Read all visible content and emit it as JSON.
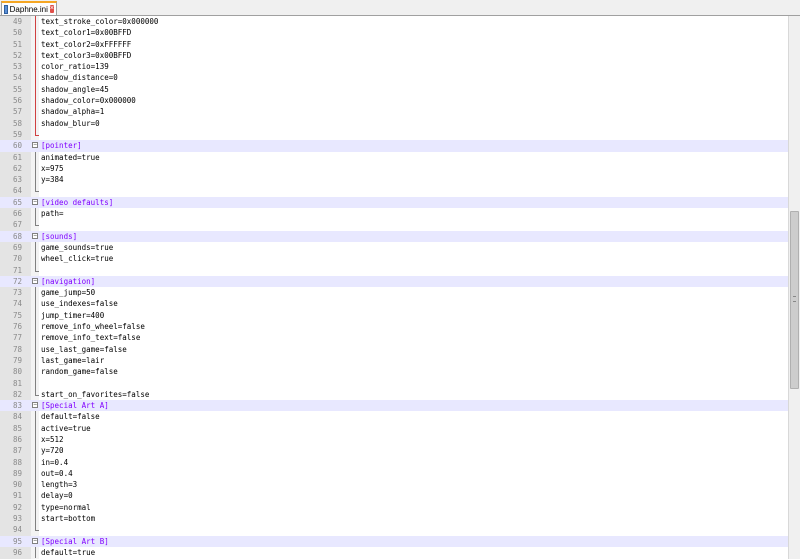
{
  "tab": {
    "label": "Daphne.ini",
    "close_glyph": "×"
  },
  "colors": {
    "section": "#8000ff",
    "gutter": "#e4e4e4",
    "highlight": "#e8e8ff",
    "fold_active": "#d04040"
  },
  "lines": [
    {
      "n": "49",
      "text": "text_stroke_color=0x000000",
      "fold": "red-line"
    },
    {
      "n": "50",
      "text": "text_color1=0x00BFFD",
      "fold": "red-line"
    },
    {
      "n": "51",
      "text": "text_color2=0xFFFFFF",
      "fold": "red-line"
    },
    {
      "n": "52",
      "text": "text_color3=0x00BFFD",
      "fold": "red-line"
    },
    {
      "n": "53",
      "text": "color_ratio=139",
      "fold": "red-line"
    },
    {
      "n": "54",
      "text": "shadow_distance=0",
      "fold": "red-line"
    },
    {
      "n": "55",
      "text": "shadow_angle=45",
      "fold": "red-line"
    },
    {
      "n": "56",
      "text": "shadow_color=0x000000",
      "fold": "red-line"
    },
    {
      "n": "57",
      "text": "shadow_alpha=1",
      "fold": "red-line"
    },
    {
      "n": "58",
      "text": "shadow_blur=0",
      "fold": "red-line"
    },
    {
      "n": "59",
      "text": "",
      "fold": "red-end"
    },
    {
      "n": "60",
      "text": "[pointer]",
      "fold": "box",
      "section": true
    },
    {
      "n": "61",
      "text": "animated=true",
      "fold": "line"
    },
    {
      "n": "62",
      "text": "x=975",
      "fold": "line"
    },
    {
      "n": "63",
      "text": "y=384",
      "fold": "line"
    },
    {
      "n": "64",
      "text": "",
      "fold": "end"
    },
    {
      "n": "65",
      "text": "[video defaults]",
      "fold": "box",
      "section": true
    },
    {
      "n": "66",
      "text": "path=",
      "fold": "line"
    },
    {
      "n": "67",
      "text": "",
      "fold": "end"
    },
    {
      "n": "68",
      "text": "[sounds]",
      "fold": "box",
      "section": true
    },
    {
      "n": "69",
      "text": "game_sounds=true",
      "fold": "line"
    },
    {
      "n": "70",
      "text": "wheel_click=true",
      "fold": "line"
    },
    {
      "n": "71",
      "text": "",
      "fold": "end"
    },
    {
      "n": "72",
      "text": "[navigation]",
      "fold": "box",
      "section": true
    },
    {
      "n": "73",
      "text": "game_jump=50",
      "fold": "line"
    },
    {
      "n": "74",
      "text": "use_indexes=false",
      "fold": "line"
    },
    {
      "n": "75",
      "text": "jump_timer=400",
      "fold": "line"
    },
    {
      "n": "76",
      "text": "remove_info_wheel=false",
      "fold": "line"
    },
    {
      "n": "77",
      "text": "remove_info_text=false",
      "fold": "line"
    },
    {
      "n": "78",
      "text": "use_last_game=false",
      "fold": "line"
    },
    {
      "n": "79",
      "text": "last_game=lair",
      "fold": "line"
    },
    {
      "n": "80",
      "text": "random_game=false",
      "fold": "line"
    },
    {
      "n": "81",
      "text": "",
      "fold": "line"
    },
    {
      "n": "82",
      "text": "start_on_favorites=false",
      "fold": "end"
    },
    {
      "n": "83",
      "text": "[Special Art A]",
      "fold": "box",
      "section": true
    },
    {
      "n": "84",
      "text": "default=false",
      "fold": "line"
    },
    {
      "n": "85",
      "text": "active=true",
      "fold": "line"
    },
    {
      "n": "86",
      "text": "x=512",
      "fold": "line"
    },
    {
      "n": "87",
      "text": "y=720",
      "fold": "line"
    },
    {
      "n": "88",
      "text": "in=0.4",
      "fold": "line"
    },
    {
      "n": "89",
      "text": "out=0.4",
      "fold": "line"
    },
    {
      "n": "90",
      "text": "length=3",
      "fold": "line"
    },
    {
      "n": "91",
      "text": "delay=0",
      "fold": "line"
    },
    {
      "n": "92",
      "text": "type=normal",
      "fold": "line"
    },
    {
      "n": "93",
      "text": "start=bottom",
      "fold": "line"
    },
    {
      "n": "94",
      "text": "",
      "fold": "end"
    },
    {
      "n": "95",
      "text": "[Special Art B]",
      "fold": "box",
      "section": true
    },
    {
      "n": "96",
      "text": "default=true",
      "fold": "line"
    }
  ]
}
